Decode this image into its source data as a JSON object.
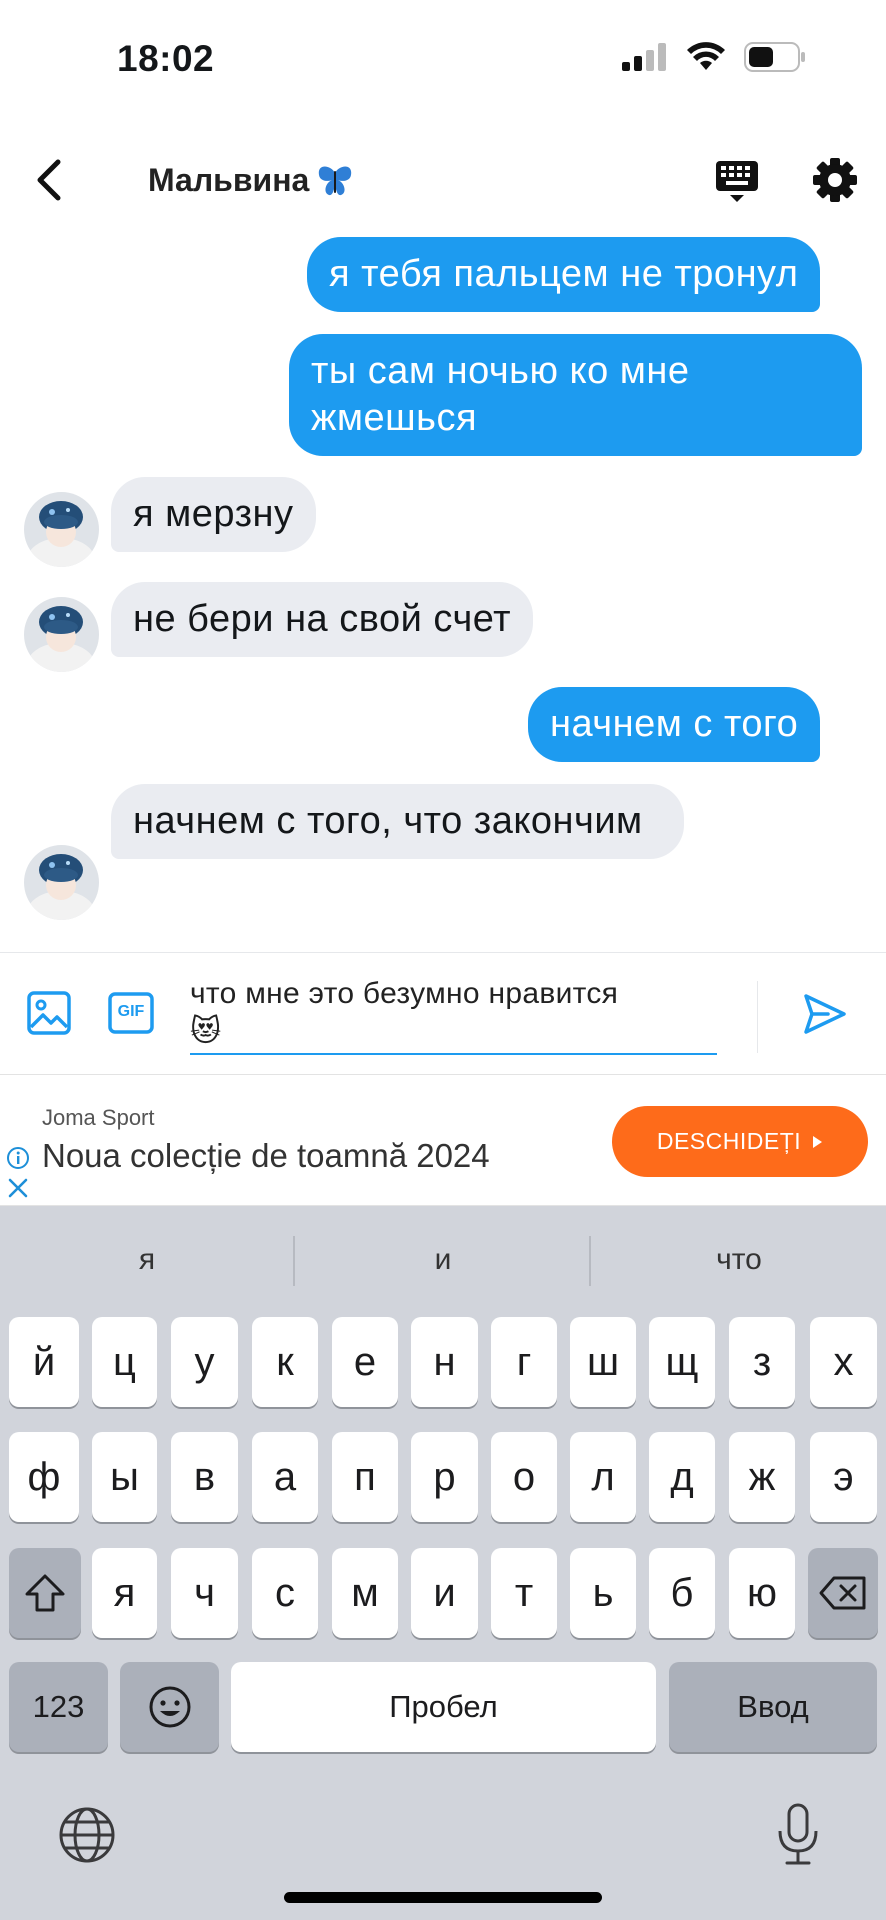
{
  "status_bar": {
    "time": "18:02"
  },
  "header": {
    "title": "Мальвина",
    "title_emoji": "🦋"
  },
  "messages": [
    {
      "direction": "out",
      "text": "я тебя пальцем не тронул"
    },
    {
      "direction": "out",
      "text": "ты сам ночью ко мне жмешься"
    },
    {
      "direction": "in",
      "text": "я мерзну"
    },
    {
      "direction": "in",
      "text": "не бери на свой счет"
    },
    {
      "direction": "out",
      "text": "начнем с того"
    },
    {
      "direction": "in",
      "text": "начнем с того, что закончим"
    }
  ],
  "composer": {
    "text": "что мне это безумно нравится",
    "emoji": "😻",
    "gif_label": "GIF"
  },
  "ad": {
    "brand": "Joma Sport",
    "headline": "Noua colecție de toamnă 2024",
    "cta": "DESCHIDEȚI"
  },
  "keyboard": {
    "suggestions": [
      "я",
      "и",
      "что"
    ],
    "row1": [
      "й",
      "ц",
      "у",
      "к",
      "е",
      "н",
      "г",
      "ш",
      "щ",
      "з",
      "х"
    ],
    "row2": [
      "ф",
      "ы",
      "в",
      "а",
      "п",
      "р",
      "о",
      "л",
      "д",
      "ж",
      "э"
    ],
    "row3": [
      "я",
      "ч",
      "с",
      "м",
      "и",
      "т",
      "ь",
      "б",
      "ю"
    ],
    "numbers_label": "123",
    "space_label": "Пробел",
    "return_label": "Ввод"
  },
  "colors": {
    "outgoing_bubble": "#1d9bf0",
    "incoming_bubble": "#eaecf1",
    "ad_cta": "#fe6b1a",
    "keyboard_bg": "#d1d4db"
  }
}
